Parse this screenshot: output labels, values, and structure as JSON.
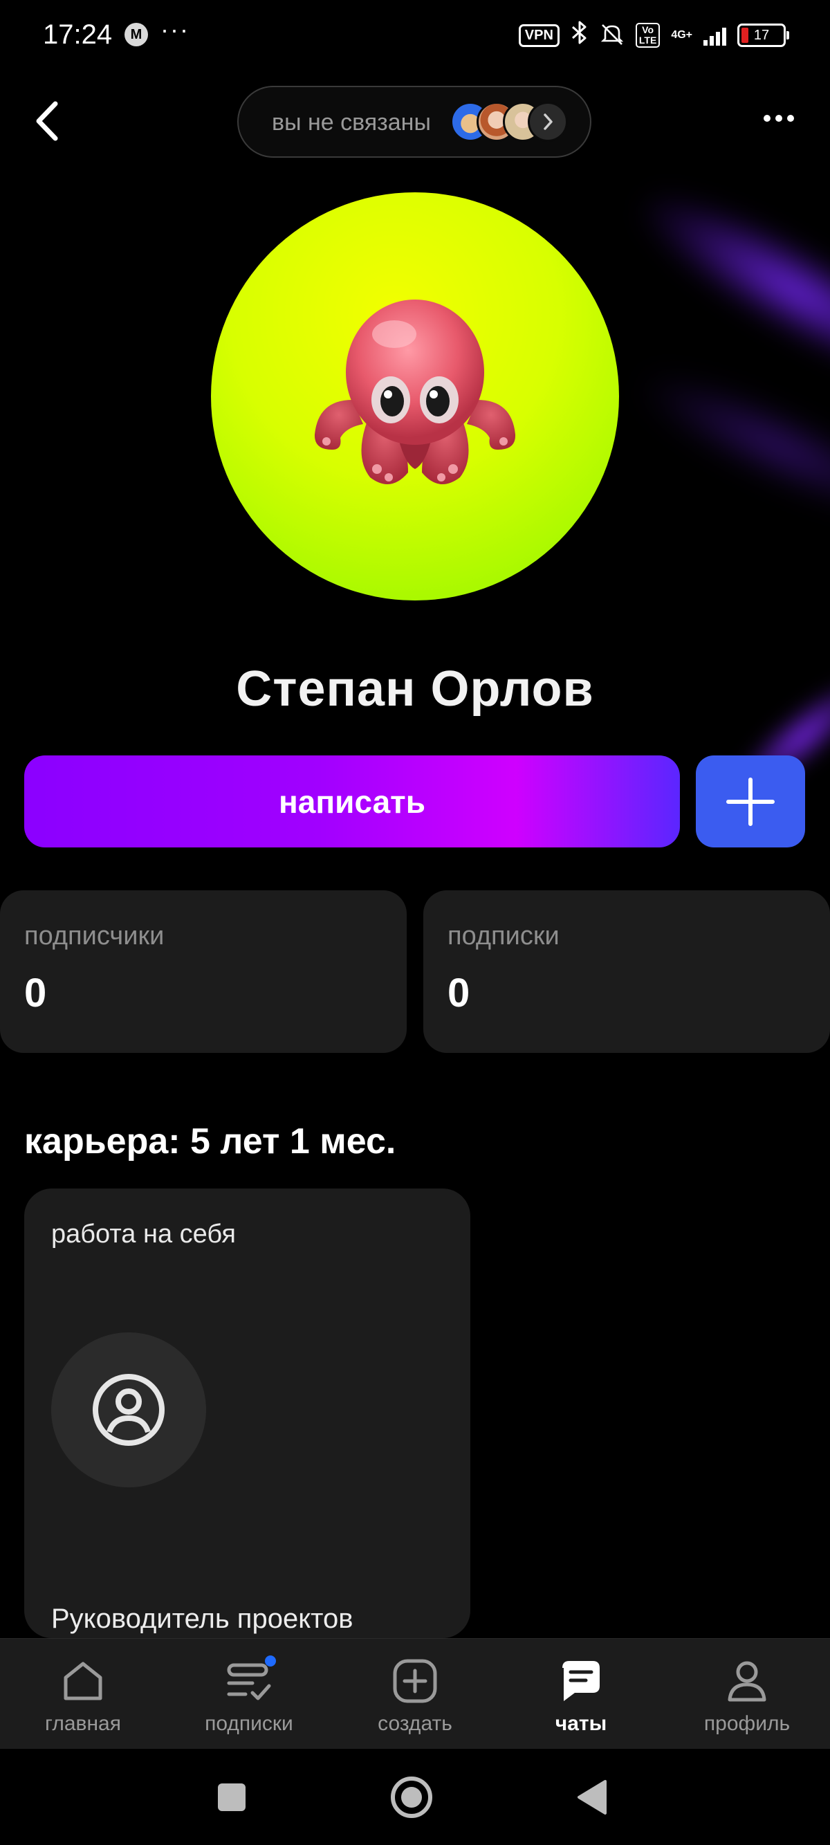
{
  "status_bar": {
    "time": "17:24",
    "left_icon": "messenger-app-icon",
    "dots": "···",
    "vpn": "VPN",
    "volte": "Vo LTE",
    "network": "4G+",
    "battery": "17"
  },
  "header": {
    "connection_text": "вы не связаны"
  },
  "profile": {
    "name": "Степан Орлов"
  },
  "actions": {
    "write_label": "написать"
  },
  "stats": {
    "followers_label": "подписчики",
    "followers_value": "0",
    "following_label": "подписки",
    "following_value": "0"
  },
  "career": {
    "title": "карьера: 5 лет 1 мес.",
    "jobs": [
      {
        "company": "работа на себя",
        "role": "Руководитель проектов"
      }
    ]
  },
  "tabbar": {
    "items": [
      {
        "label": "главная",
        "icon": "home-icon"
      },
      {
        "label": "подписки",
        "icon": "subscriptions-icon"
      },
      {
        "label": "создать",
        "icon": "plus-square-icon"
      },
      {
        "label": "чаты",
        "icon": "chat-icon"
      },
      {
        "label": "профиль",
        "icon": "person-icon"
      }
    ],
    "active": "чаты"
  },
  "colors": {
    "background": "#000000",
    "write_gradient_start": "#8b00ff",
    "write_gradient_end": "#5b26ff",
    "add_button": "#3b5cf0",
    "card": "#1c1c1c",
    "avatar_bg": "#d8ff00"
  }
}
